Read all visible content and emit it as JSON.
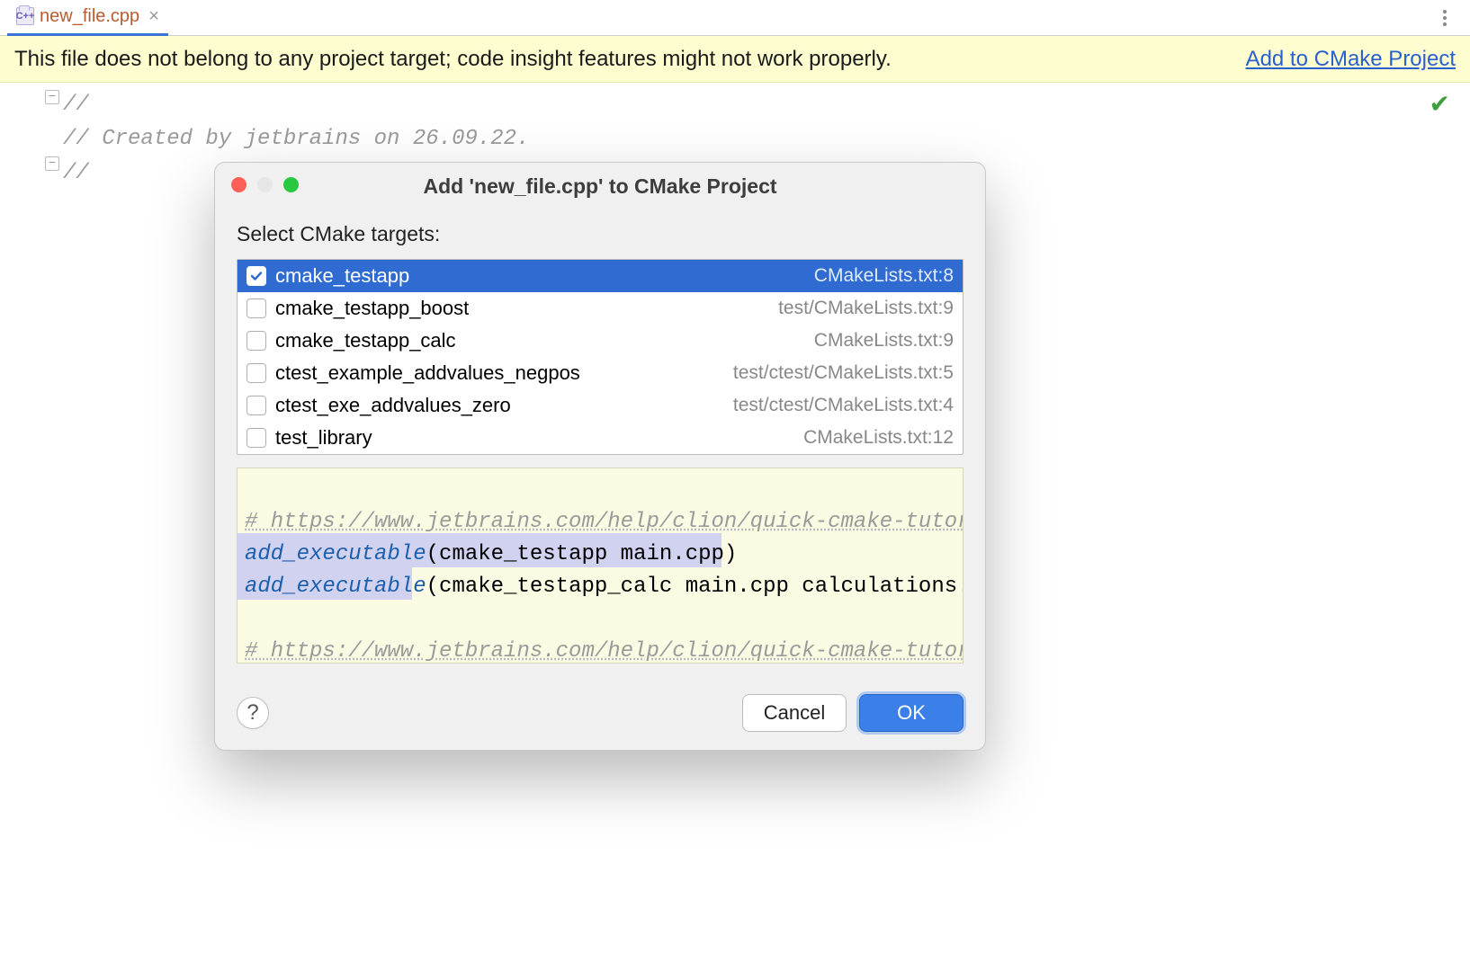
{
  "tab": {
    "filename": "new_file.cpp"
  },
  "banner": {
    "text": "This file does not belong to any project target; code insight features might not work properly.",
    "link": "Add to CMake Project"
  },
  "editor": {
    "lines": [
      "//",
      "// Created by jetbrains on 26.09.22.",
      "//"
    ]
  },
  "dialog": {
    "title": "Add 'new_file.cpp' to CMake Project",
    "section_label": "Select CMake targets:",
    "targets": [
      {
        "name": "cmake_testapp",
        "loc": "CMakeLists.txt:8",
        "checked": true,
        "selected": true
      },
      {
        "name": "cmake_testapp_boost",
        "loc": "test/CMakeLists.txt:9",
        "checked": false,
        "selected": false
      },
      {
        "name": "cmake_testapp_calc",
        "loc": "CMakeLists.txt:9",
        "checked": false,
        "selected": false
      },
      {
        "name": "ctest_example_addvalues_negpos",
        "loc": "test/ctest/CMakeLists.txt:5",
        "checked": false,
        "selected": false
      },
      {
        "name": "ctest_exe_addvalues_zero",
        "loc": "test/ctest/CMakeLists.txt:4",
        "checked": false,
        "selected": false
      },
      {
        "name": "test_library",
        "loc": "CMakeLists.txt:12",
        "checked": false,
        "selected": false
      }
    ],
    "preview": {
      "comment": "# https://www.jetbrains.com/help/clion/quick-cmake-tutorial.ht",
      "line1_fn": "add_executable",
      "line1_args": "(cmake_testapp main.cpp)",
      "line2_fn": "add_executable",
      "line2_args": "(cmake_testapp_calc main.cpp calculations.cpp ca",
      "comment2": "# https://www.jetbrains.com/help/clion/quick-cmake-tutorial.ht"
    },
    "buttons": {
      "cancel": "Cancel",
      "ok": "OK",
      "help": "?"
    }
  }
}
